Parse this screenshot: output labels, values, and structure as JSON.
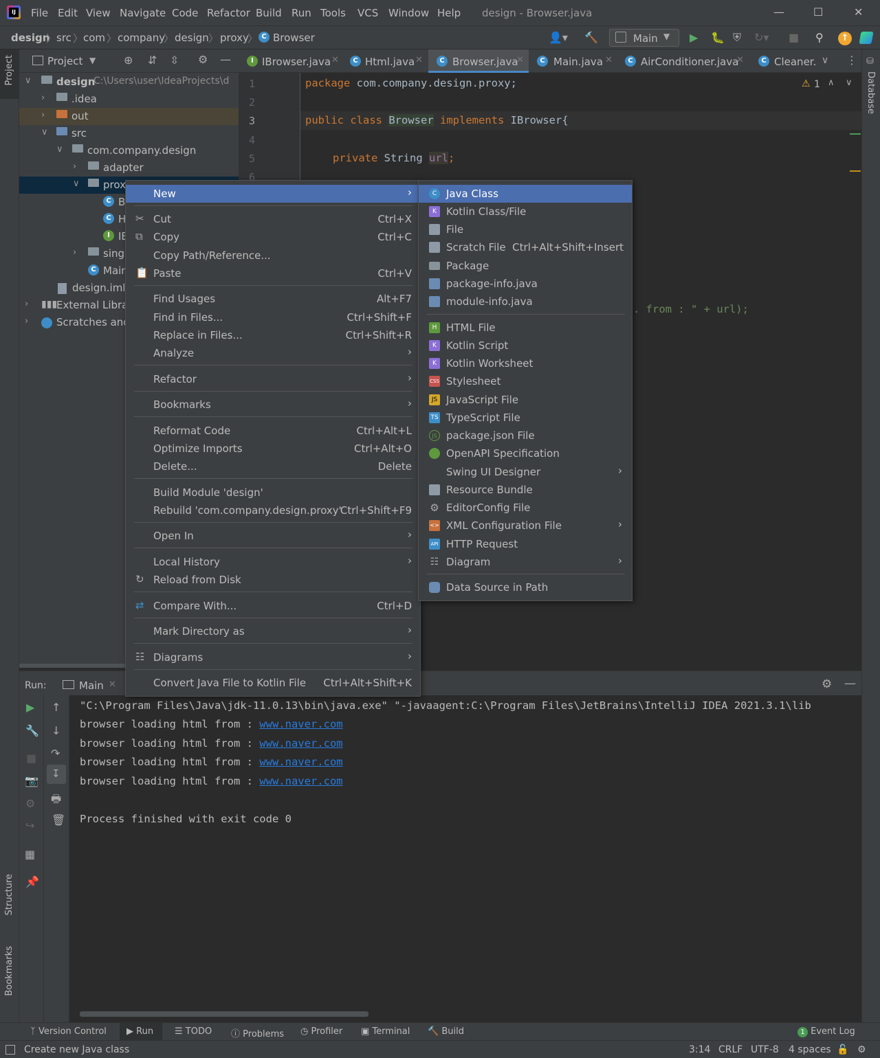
{
  "titlebar": {
    "menu": [
      "File",
      "Edit",
      "View",
      "Navigate",
      "Code",
      "Refactor",
      "Build",
      "Run",
      "Tools",
      "VCS",
      "Window",
      "Help"
    ],
    "title": "design - Browser.java"
  },
  "navbar": {
    "breadcrumbs": [
      "design",
      "src",
      "com",
      "company",
      "design",
      "proxy",
      "Browser"
    ],
    "run_config": "Main"
  },
  "left_stripe": {
    "project": "Project",
    "structure": "Structure",
    "bookmarks": "Bookmarks"
  },
  "right_stripe": {
    "database": "Database"
  },
  "project_panel": {
    "title": "Project",
    "tree": [
      {
        "label": "design",
        "path": "C:\\Users\\user\\IdeaProjects\\d"
      },
      {
        "label": ".idea"
      },
      {
        "label": "out"
      },
      {
        "label": "src"
      },
      {
        "label": "com.company.design"
      },
      {
        "label": "adapter"
      },
      {
        "label": "proxy"
      },
      {
        "label": "B"
      },
      {
        "label": "H"
      },
      {
        "label": "IE"
      },
      {
        "label": "singl"
      },
      {
        "label": "Main"
      },
      {
        "label": "design.iml"
      },
      {
        "label": "External Librari"
      },
      {
        "label": "Scratches and"
      }
    ]
  },
  "tabs": [
    {
      "label": "IBrowser.java"
    },
    {
      "label": "Html.java"
    },
    {
      "label": "Browser.java"
    },
    {
      "label": "Main.java"
    },
    {
      "label": "AirConditioner.java"
    },
    {
      "label": "Cleaner."
    }
  ],
  "editor": {
    "line_numbers": [
      "1",
      "2",
      "3",
      "4",
      "5",
      "6"
    ],
    "code": {
      "l1_kw": "package",
      "l1_rest": " com.company.design.proxy;",
      "l3_kw1": "public class",
      "l3_name": "Browser",
      "l3_kw2": "implements",
      "l3_rest": " IBrowser{",
      "l5_kw": "private",
      "l5_type": " String ",
      "l5_field": "url",
      "l5_end": ";",
      "partial": ". from : \" + url);"
    },
    "warnings": "1"
  },
  "run_panel": {
    "label": "Run:",
    "tab": "Main",
    "output": [
      "\"C:\\Program Files\\Java\\jdk-11.0.13\\bin\\java.exe\" \"-javaagent:C:\\Program Files\\JetBrains\\IntelliJ IDEA 2021.3.1\\lib",
      "browser loading html from : ",
      "browser loading html from : ",
      "browser loading html from : ",
      "browser loading html from : ",
      "Process finished with exit code 0"
    ],
    "link": "www.naver.com"
  },
  "context_menu": {
    "items": [
      {
        "label": "New",
        "shortcut": ""
      },
      {
        "label": "Cut",
        "shortcut": "Ctrl+X"
      },
      {
        "label": "Copy",
        "shortcut": "Ctrl+C"
      },
      {
        "label": "Copy Path/Reference...",
        "shortcut": ""
      },
      {
        "label": "Paste",
        "shortcut": "Ctrl+V"
      },
      {
        "label": "Find Usages",
        "shortcut": "Alt+F7"
      },
      {
        "label": "Find in Files...",
        "shortcut": "Ctrl+Shift+F"
      },
      {
        "label": "Replace in Files...",
        "shortcut": "Ctrl+Shift+R"
      },
      {
        "label": "Analyze",
        "shortcut": ""
      },
      {
        "label": "Refactor",
        "shortcut": ""
      },
      {
        "label": "Bookmarks",
        "shortcut": ""
      },
      {
        "label": "Reformat Code",
        "shortcut": "Ctrl+Alt+L"
      },
      {
        "label": "Optimize Imports",
        "shortcut": "Ctrl+Alt+O"
      },
      {
        "label": "Delete...",
        "shortcut": "Delete"
      },
      {
        "label": "Build Module 'design'",
        "shortcut": ""
      },
      {
        "label": "Rebuild 'com.company.design.proxy'",
        "shortcut": "Ctrl+Shift+F9"
      },
      {
        "label": "Open In",
        "shortcut": ""
      },
      {
        "label": "Local History",
        "shortcut": ""
      },
      {
        "label": "Reload from Disk",
        "shortcut": ""
      },
      {
        "label": "Compare With...",
        "shortcut": "Ctrl+D"
      },
      {
        "label": "Mark Directory as",
        "shortcut": ""
      },
      {
        "label": "Diagrams",
        "shortcut": ""
      },
      {
        "label": "Convert Java File to Kotlin File",
        "shortcut": "Ctrl+Alt+Shift+K"
      }
    ]
  },
  "new_submenu": {
    "items": [
      {
        "label": "Java Class",
        "shortcut": ""
      },
      {
        "label": "Kotlin Class/File",
        "shortcut": ""
      },
      {
        "label": "File",
        "shortcut": ""
      },
      {
        "label": "Scratch File",
        "shortcut": "Ctrl+Alt+Shift+Insert"
      },
      {
        "label": "Package",
        "shortcut": ""
      },
      {
        "label": "package-info.java",
        "shortcut": ""
      },
      {
        "label": "module-info.java",
        "shortcut": ""
      },
      {
        "label": "HTML File",
        "shortcut": ""
      },
      {
        "label": "Kotlin Script",
        "shortcut": ""
      },
      {
        "label": "Kotlin Worksheet",
        "shortcut": ""
      },
      {
        "label": "Stylesheet",
        "shortcut": ""
      },
      {
        "label": "JavaScript File",
        "shortcut": ""
      },
      {
        "label": "TypeScript File",
        "shortcut": ""
      },
      {
        "label": "package.json File",
        "shortcut": ""
      },
      {
        "label": "OpenAPI Specification",
        "shortcut": ""
      },
      {
        "label": "Swing UI Designer",
        "shortcut": ""
      },
      {
        "label": "Resource Bundle",
        "shortcut": ""
      },
      {
        "label": "EditorConfig File",
        "shortcut": ""
      },
      {
        "label": "XML Configuration File",
        "shortcut": ""
      },
      {
        "label": "HTTP Request",
        "shortcut": ""
      },
      {
        "label": "Diagram",
        "shortcut": ""
      },
      {
        "label": "Data Source in Path",
        "shortcut": ""
      }
    ]
  },
  "bottom_tools": [
    "Version Control",
    "Run",
    "TODO",
    "Problems",
    "Profiler",
    "Terminal",
    "Build",
    "Event Log"
  ],
  "event_log_count": "1",
  "status": {
    "message": "Create new Java class",
    "position": "3:14",
    "line_sep": "CRLF",
    "encoding": "UTF-8",
    "indent": "4 spaces"
  }
}
